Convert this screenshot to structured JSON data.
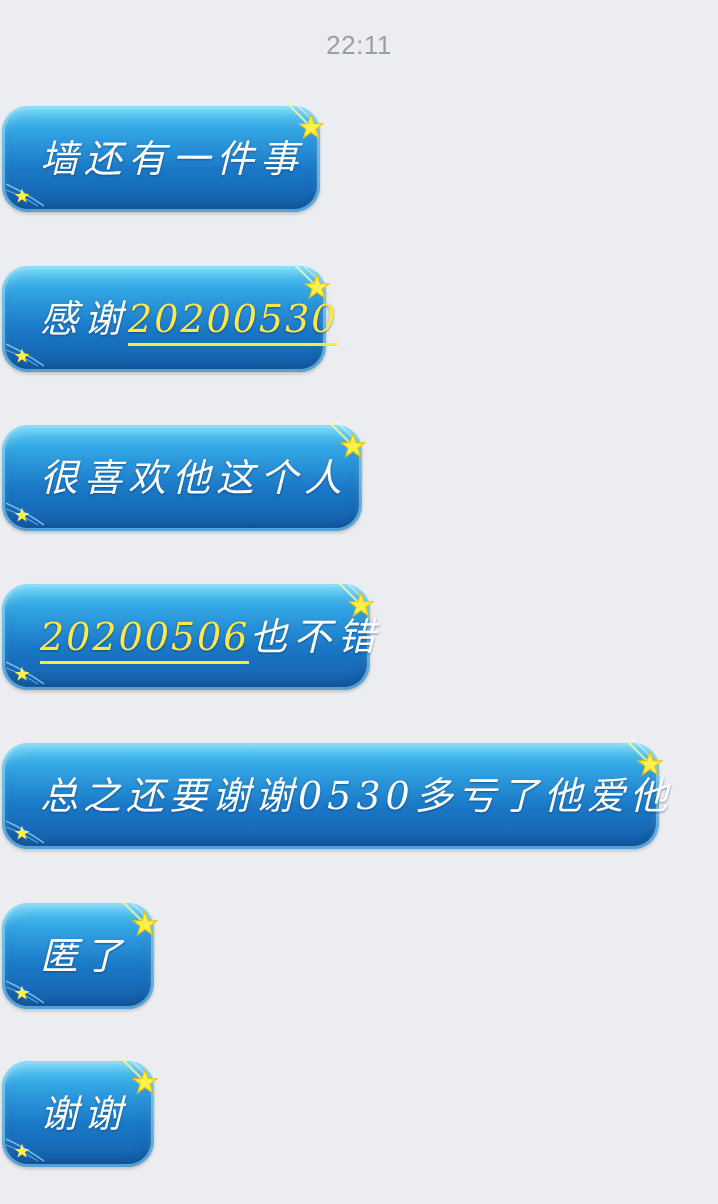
{
  "chat": {
    "timestamp": "22:11",
    "messages": [
      {
        "parts": [
          {
            "text": "墙还有一件事",
            "highlight": false
          }
        ]
      },
      {
        "parts": [
          {
            "text": "感谢",
            "highlight": false
          },
          {
            "text": "20200530",
            "highlight": true
          }
        ]
      },
      {
        "parts": [
          {
            "text": "很喜欢他这个人",
            "highlight": false
          }
        ]
      },
      {
        "parts": [
          {
            "text": "20200506",
            "highlight": true
          },
          {
            "text": "也不错",
            "highlight": false
          }
        ]
      },
      {
        "parts": [
          {
            "text": "总之还要谢谢0530多亏了他爱他",
            "highlight": false
          }
        ]
      },
      {
        "parts": [
          {
            "text": "匿了",
            "highlight": false
          }
        ]
      },
      {
        "parts": [
          {
            "text": "谢谢",
            "highlight": false
          }
        ]
      }
    ]
  },
  "theme": {
    "background": "#ebedf1",
    "bubble_color": "#1a78c7",
    "highlight_color": "#ffe74a",
    "star_color": "#fff04a",
    "decorations": [
      "star-icon",
      "star-small-icon"
    ]
  }
}
